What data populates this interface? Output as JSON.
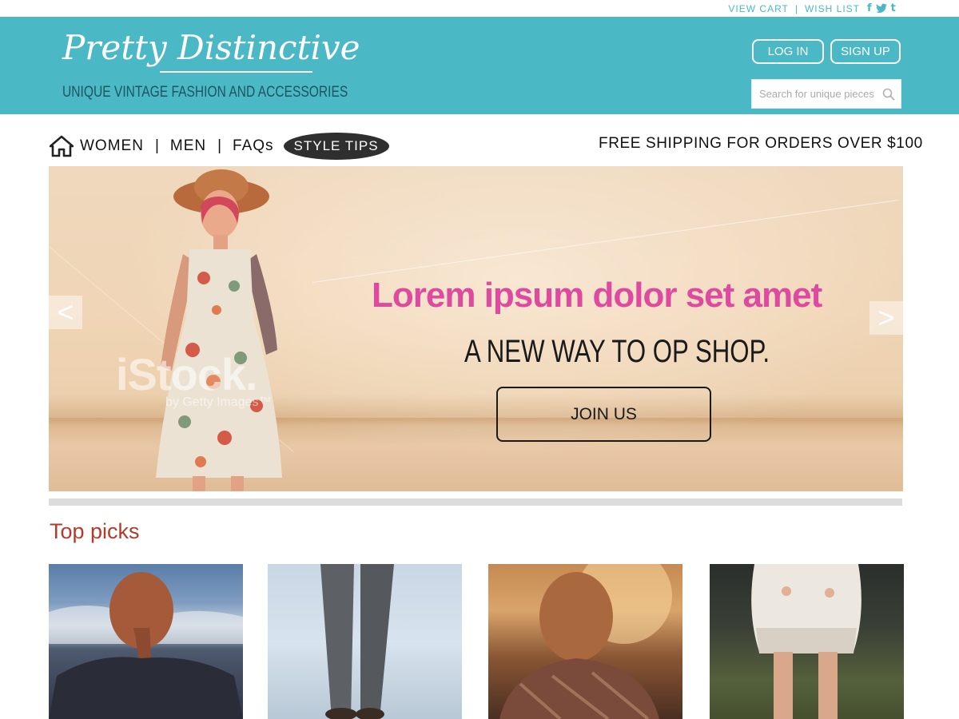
{
  "utility": {
    "view_cart": "VIEW  CART",
    "sep": "|",
    "wish_list": "WISH  LIST",
    "social": [
      "f",
      "t",
      "t"
    ]
  },
  "header": {
    "logo": "Pretty Distinctive",
    "tagline": "UNIQUE VINTAGE FASHION AND ACCESSORIES",
    "login": "LOG IN",
    "signup": "SIGN UP",
    "search_placeholder": "Search for unique pieces",
    "search_icon": "search-icon"
  },
  "nav": {
    "items": [
      "WOMEN",
      "MEN",
      "FAQs"
    ],
    "separator": "|",
    "pill": "STYLE  TIPS",
    "free_shipping": "FREE SHIPPING FOR ORDERS OVER $100"
  },
  "hero": {
    "title": "Lorem ipsum dolor set amet",
    "subtitle": "A NEW WAY TO OP SHOP.",
    "cta": "JOIN US",
    "watermark": "iStock.",
    "watermark_sub": "by Getty Images™",
    "prev": "<",
    "next": ">"
  },
  "top_picks": {
    "title": "Top picks"
  },
  "colors": {
    "header_bg": "#4bb8c6",
    "accent_pink": "#de4aa0",
    "section_title": "#b63a2a"
  }
}
